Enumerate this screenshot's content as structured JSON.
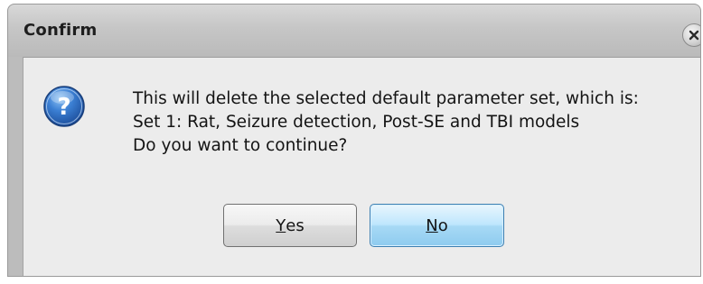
{
  "dialog": {
    "title": "Confirm",
    "close_icon": "close-icon",
    "question_icon": "question-icon",
    "message_lines": [
      "This will delete the selected default parameter set, which is:",
      "Set 1: Rat, Seizure detection, Post-SE and TBI models",
      "Do you want to continue?"
    ],
    "buttons": {
      "yes": {
        "mnemonic": "Y",
        "rest": "es"
      },
      "no": {
        "mnemonic": "N",
        "rest": "o"
      }
    },
    "colors": {
      "default_button": "#bee6fd",
      "icon_blue": "#2f6fc4"
    }
  }
}
